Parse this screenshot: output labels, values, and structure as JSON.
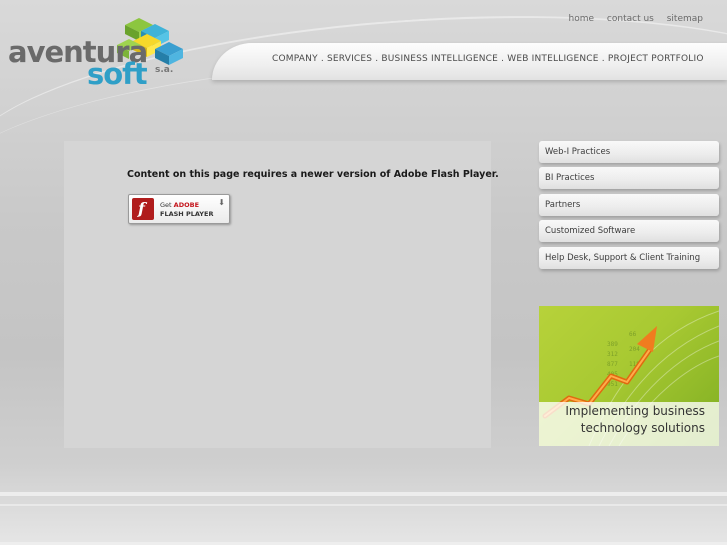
{
  "brand": {
    "name_part1": "aventura",
    "name_part2": "soft",
    "suffix": "s.a."
  },
  "top_links": {
    "home": "home",
    "contact": "contact us",
    "sitemap": "sitemap"
  },
  "main_nav": {
    "text": "COMPANY . SERVICES . BUSINESS INTELLIGENCE . WEB INTELLIGENCE . PROJECT PORTFOLIO"
  },
  "content": {
    "flash_message": "Content on this page requires a newer version of Adobe Flash Player.",
    "badge_line1_prefix": "Get",
    "badge_line1_brand": "ADOBE",
    "badge_line2": "FLASH PLAYER"
  },
  "side_menu": {
    "items": [
      {
        "label": "Web-I Practices"
      },
      {
        "label": "BI Practices"
      },
      {
        "label": "Partners"
      },
      {
        "label": "Customized Software"
      },
      {
        "label": "Help Desk, Support & Client Training"
      }
    ]
  },
  "promo": {
    "line1": "Implementing business",
    "line2": "technology solutions"
  },
  "colors": {
    "brand_blue": "#2f9fc7",
    "brand_gray": "#6a6a6a",
    "flash_red": "#b01c1c",
    "promo_green": "#a8c932",
    "promo_arrow": "#f07c1f"
  }
}
